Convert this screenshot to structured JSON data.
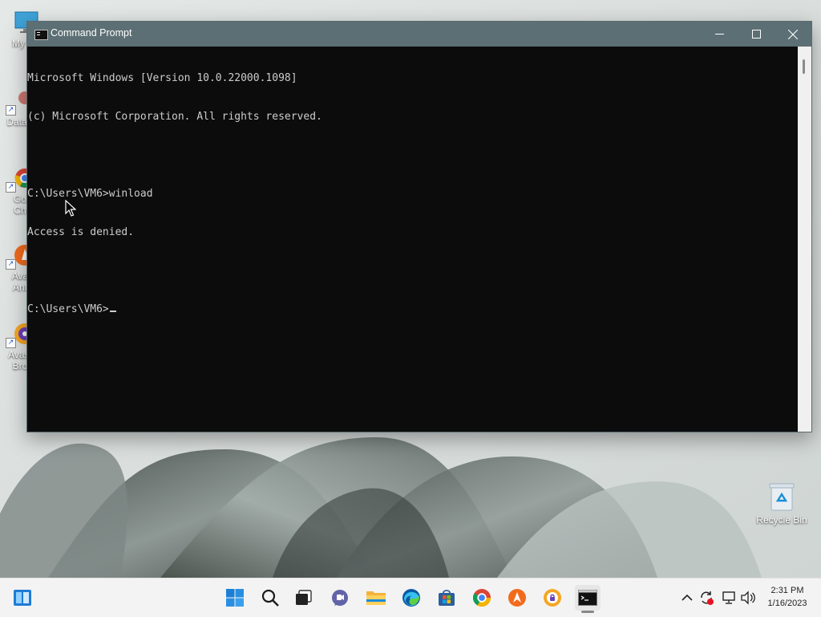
{
  "desktop": {
    "icons": [
      {
        "label": "My C",
        "name": "this-pc-icon"
      },
      {
        "label": "DataV",
        "name": "datav-icon"
      },
      {
        "label": "Go\nCh",
        "name": "chrome-desktop-icon"
      },
      {
        "label": "Ava\nAnt",
        "name": "avast-antivirus-icon"
      },
      {
        "label": "Avast\nBro",
        "name": "avast-browser-icon"
      }
    ],
    "recycle_bin_label": "Recycle Bin"
  },
  "window": {
    "title": "Command Prompt",
    "console_lines": [
      "Microsoft Windows [Version 10.0.22000.1098]",
      "(c) Microsoft Corporation. All rights reserved.",
      "",
      "C:\\Users\\VM6>winload",
      "Access is denied.",
      "",
      "C:\\Users\\VM6>"
    ]
  },
  "taskbar": {
    "pinned": [
      {
        "name": "start-icon"
      },
      {
        "name": "search-icon"
      },
      {
        "name": "task-view-icon"
      },
      {
        "name": "teams-chat-icon"
      },
      {
        "name": "file-explorer-icon"
      },
      {
        "name": "edge-icon"
      },
      {
        "name": "microsoft-store-icon"
      },
      {
        "name": "chrome-icon"
      },
      {
        "name": "avast-antivirus-icon"
      },
      {
        "name": "avast-secure-browser-icon"
      },
      {
        "name": "command-prompt-icon"
      }
    ],
    "clock": {
      "time": "2:31 PM",
      "date": "1/16/2023"
    }
  },
  "colors": {
    "title_bar": "#5c6f74",
    "console_bg": "#0c0c0c",
    "console_text": "#cccccc",
    "taskbar_bg": "#f3f3f3"
  }
}
